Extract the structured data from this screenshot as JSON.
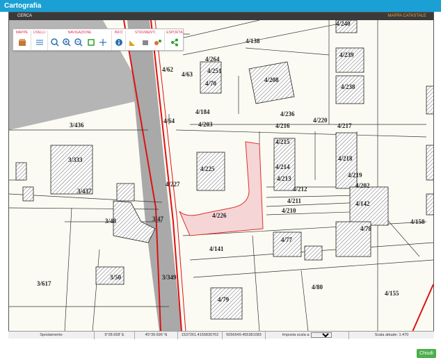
{
  "window": {
    "title": "Cartografia"
  },
  "topstrip": {
    "left": "CERCA",
    "right": "MAPPA CATASTALE"
  },
  "toolbar": {
    "groups": [
      {
        "title": "MAPPE"
      },
      {
        "title": "LIVELLI"
      },
      {
        "title": "NAVIGAZIONE"
      },
      {
        "title": "INFO"
      },
      {
        "title": "STRUMENTI"
      },
      {
        "title": "ESPORTA"
      }
    ]
  },
  "parcels": [
    "4/240",
    "4/138",
    "4/264",
    "4/251",
    "4/70",
    "4/62",
    "4/63",
    "4/208",
    "4/239",
    "4/238",
    "4/236",
    "4/184",
    "4/64",
    "4/203",
    "4/216",
    "4/220",
    "4/217",
    "3/436",
    "4/215",
    "3/333",
    "4/225",
    "4/214",
    "4/218",
    "4/213",
    "4/219",
    "4/202",
    "4/212",
    "3/437",
    "4/227",
    "4/211",
    "4/142",
    "4/210",
    "3/48",
    "3/47",
    "4/226",
    "4/78",
    "4/158",
    "4/77",
    "4/141",
    "3/50",
    "3/349",
    "3/617",
    "4/80",
    "4/155",
    "4/79"
  ],
  "statusbar": {
    "mode": "Spostamento",
    "lon": "9°28.658' E",
    "lat": "45°39.696' N",
    "x": "1537261.4156830762",
    "y": "5056649.455381083",
    "scale_label": "Imposta scala a:",
    "current_scale": "Scala attuale: 1:470"
  },
  "close_label": "Chiudi",
  "colors": {
    "titlebar": "#1aa0d4",
    "road_edge": "#e01010",
    "accent": "#e0334f",
    "close_button": "#4cae4c"
  }
}
